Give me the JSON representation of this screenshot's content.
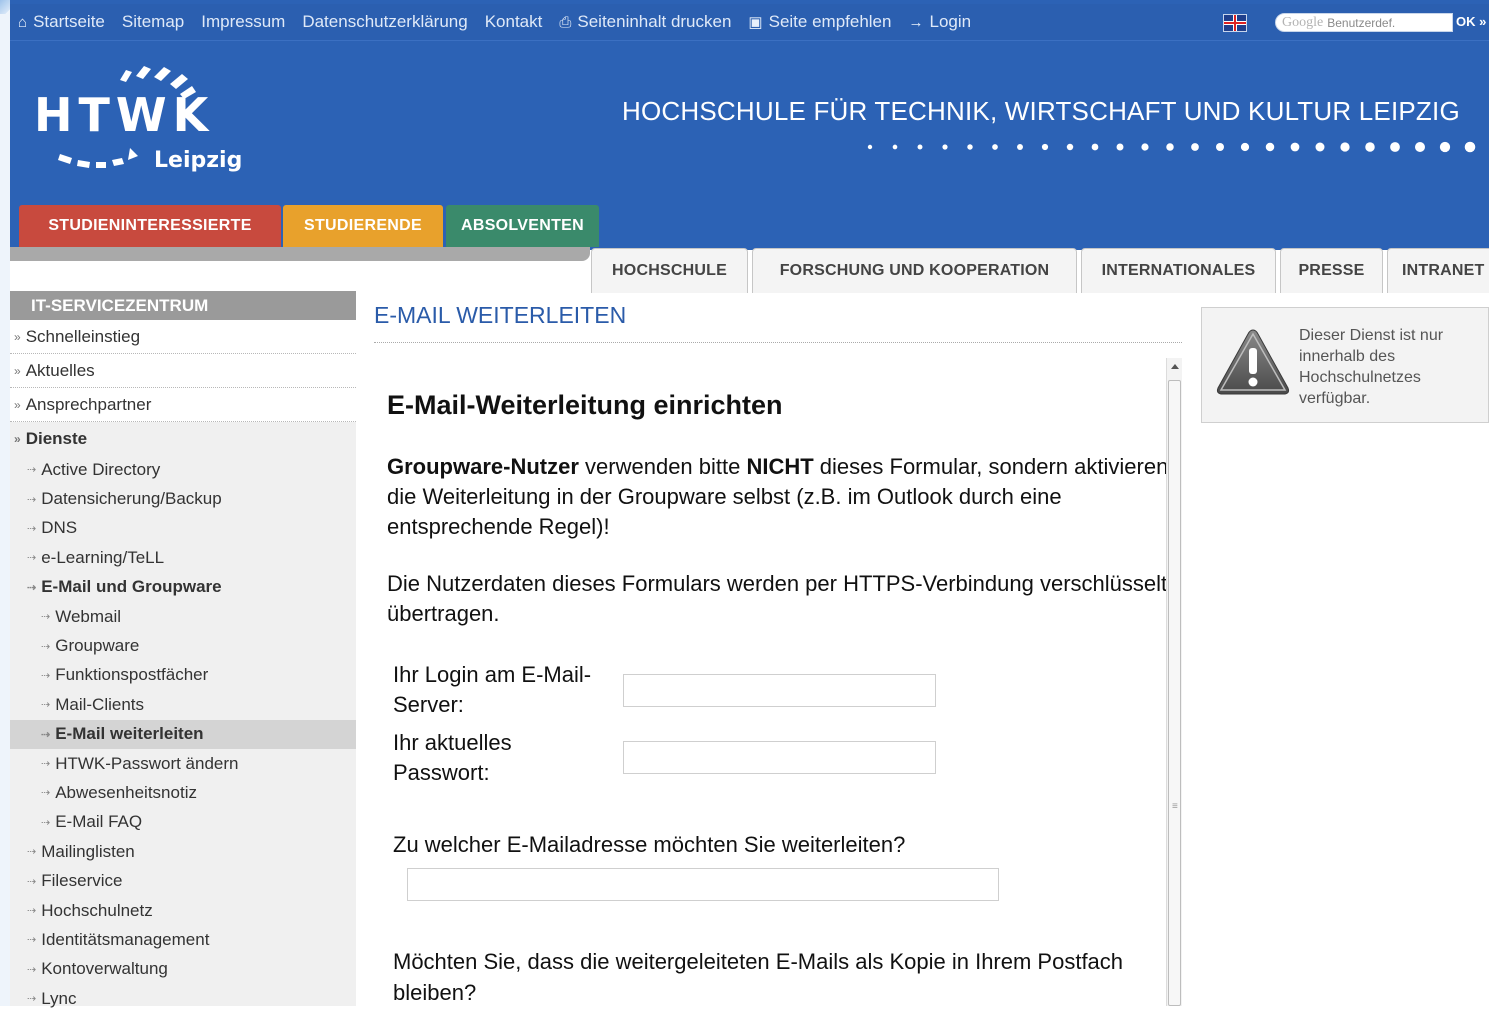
{
  "topnav": {
    "items": [
      {
        "label": "Startseite",
        "icon": "home-icon"
      },
      {
        "label": "Sitemap"
      },
      {
        "label": "Impressum"
      },
      {
        "label": "Datenschutzerklärung"
      },
      {
        "label": "Kontakt"
      },
      {
        "label": "Seiteninhalt drucken",
        "icon": "print-icon"
      },
      {
        "label": "Seite empfehlen",
        "icon": "recommend-icon"
      },
      {
        "label": "Login",
        "icon": "key-icon"
      }
    ],
    "language_flag": "uk-flag-icon",
    "search_brand": "Google",
    "search_placeholder": "Benutzerdef.",
    "search_ok": "OK »"
  },
  "header": {
    "logo_letters": "HTWK",
    "logo_city": "Leipzig",
    "slogan": "HOCHSCHULE FÜR TECHNIK, WIRTSCHAFT UND KULTUR LEIPZIG"
  },
  "main_tabs": [
    {
      "label": "STUDIENINTERESSIERTE",
      "color": "#c84a3e"
    },
    {
      "label": "STUDIERENDE",
      "color": "#e8a12c"
    },
    {
      "label": "ABSOLVENTEN",
      "color": "#3a8a6b"
    }
  ],
  "secondary_tabs": [
    {
      "label": "HOCHSCHULE"
    },
    {
      "label": "FORSCHUNG UND KOOPERATION"
    },
    {
      "label": "INTERNATIONALES"
    },
    {
      "label": "PRESSE"
    },
    {
      "label": "INTRANET"
    }
  ],
  "sidebar": {
    "title": "IT-SERVICEZENTRUM",
    "level1": [
      "Schnelleinstieg",
      "Aktuelles",
      "Ansprechpartner",
      "Dienste"
    ],
    "dienste": [
      "Active Directory",
      "Datensicherung/Backup",
      "DNS",
      "e-Learning/TeLL",
      "E-Mail und Groupware"
    ],
    "email_sub": [
      "Webmail",
      "Groupware",
      "Funktionspostfächer",
      "Mail-Clients",
      "E-Mail weiterleiten",
      "HTWK-Passwort ändern",
      "Abwesenheitsnotiz",
      "E-Mail FAQ"
    ],
    "dienste_more": [
      "Mailinglisten",
      "Fileservice",
      "Hochschulnetz",
      "Identitätsmanagement",
      "Kontoverwaltung",
      "Lync"
    ]
  },
  "content": {
    "page_title": "E-MAIL WEITERLEITEN",
    "form_heading": "E-Mail-Weiterleitung einrichten",
    "para1_bold1": "Groupware-Nutzer",
    "para1_text1": " verwenden bitte ",
    "para1_bold2": "NICHT",
    "para1_text2": " dieses Formular, sondern aktivieren die Weiterleitung in der Groupware selbst (z.B. im Outlook durch eine entsprechende Regel)!",
    "para2": "Die Nutzerdaten dieses Formulars werden per HTTPS-Verbindung verschlüsselt übertragen.",
    "login_label": "Ihr Login am E-Mail-Server:",
    "password_label": "Ihr aktuelles Passwort:",
    "login_value": "",
    "password_value": "",
    "forward_question": "Zu welcher E-Mailadresse möchten Sie weiterleiten?",
    "forward_value": "",
    "copy_question": "Möchten Sie, dass die weitergeleiteten E-Mails als Kopie in Ihrem Postfach bleiben?"
  },
  "notice": {
    "text": "Dieser Dienst ist nur innerhalb des Hochschulnetzes verfügbar.",
    "icon": "warning-icon"
  }
}
